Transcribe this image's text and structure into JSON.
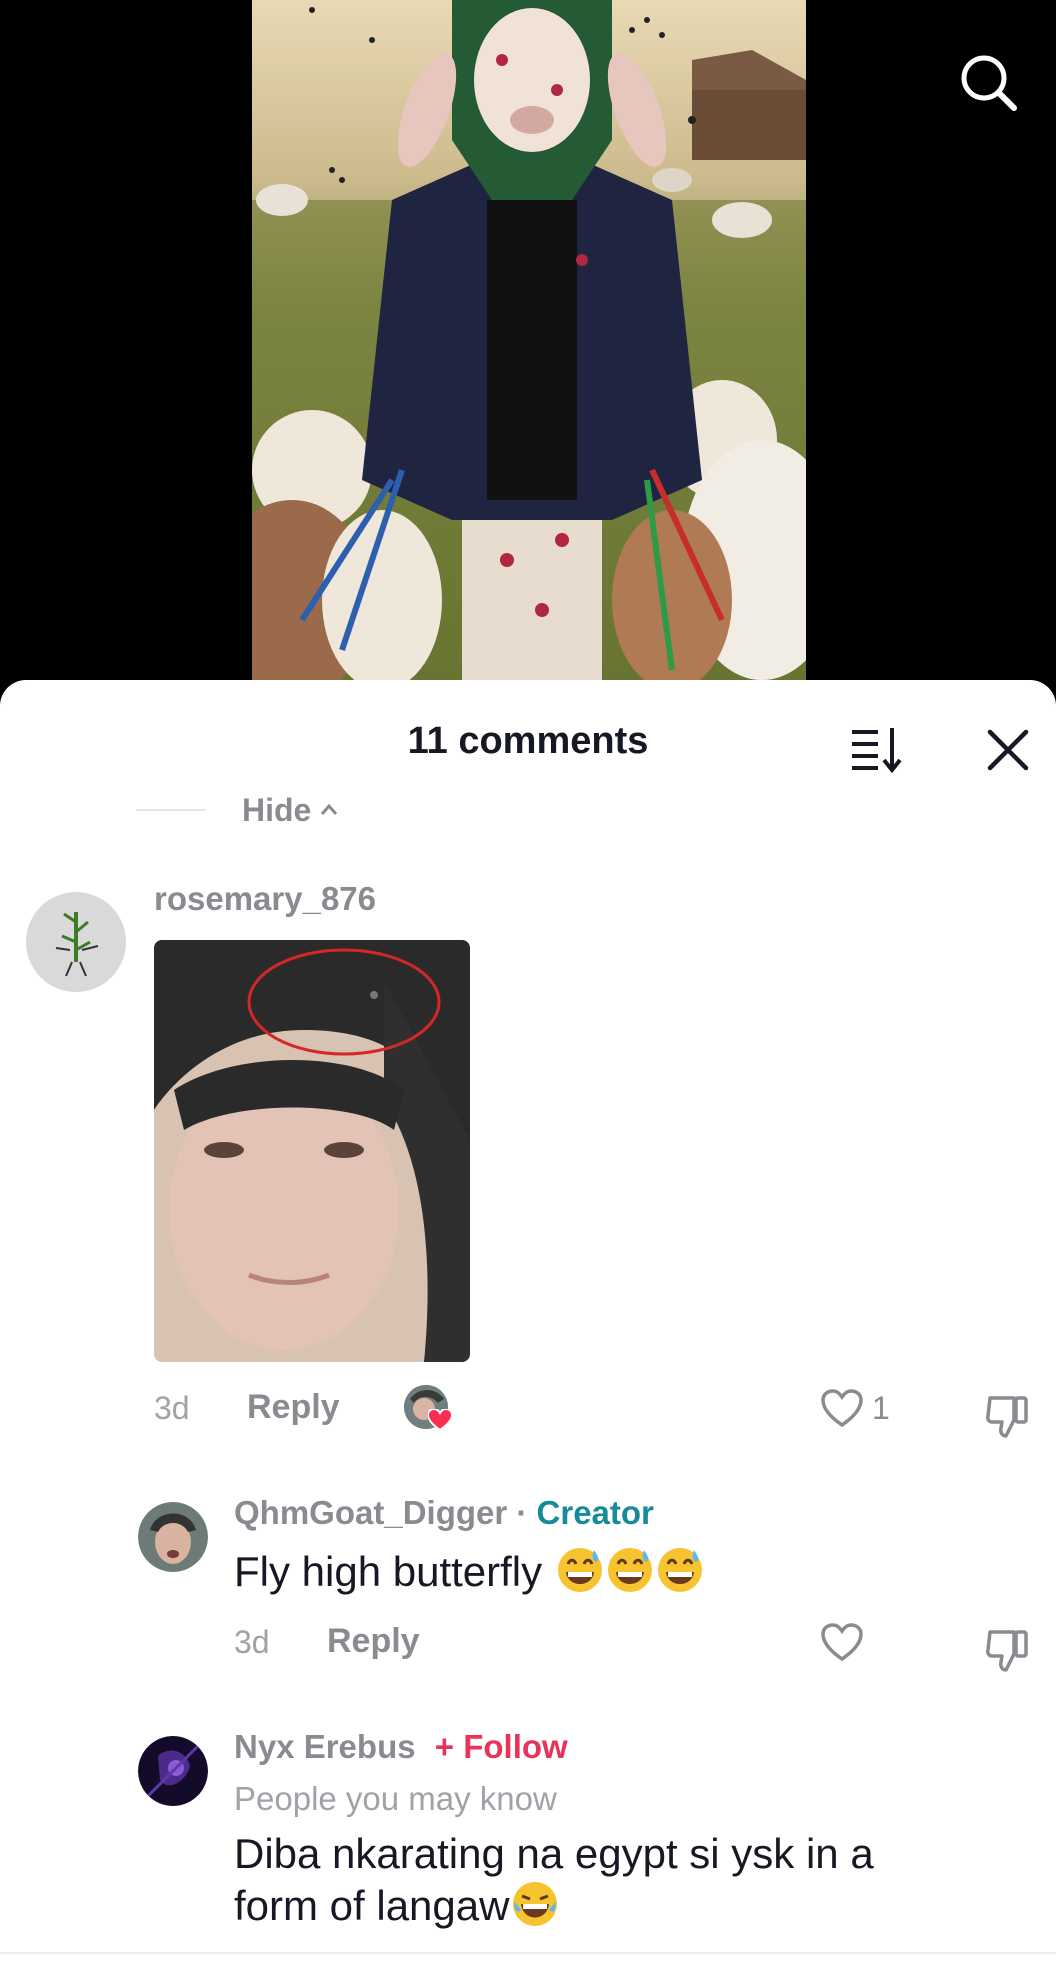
{
  "header": {
    "comment_count_title": "11 comments"
  },
  "thread": {
    "hide_label": "Hide"
  },
  "comments": [
    {
      "username": "rosemary_876",
      "time": "3d",
      "reply_label": "Reply",
      "likes": "1",
      "has_image": true,
      "creator_liked": true
    },
    {
      "username": "QhmGoat_Digger",
      "separator": " · ",
      "badge": "Creator",
      "text": "Fly high butterfly ",
      "emojis": [
        "grinning-sweat-emoji",
        "grinning-sweat-emoji",
        "grinning-sweat-emoji"
      ],
      "time": "3d",
      "reply_label": "Reply"
    },
    {
      "username": "Nyx Erebus",
      "follow_label": "+ Follow",
      "subline": "People you may know",
      "text_line1": "Diba nkarating na egypt si ysk in a",
      "text_line2": "form of langaw",
      "emoji": "tears-of-joy-emoji"
    }
  ],
  "colors": {
    "creator": "#168b9a",
    "follow": "#e8335a",
    "liked_heart": "#fe2c55"
  }
}
